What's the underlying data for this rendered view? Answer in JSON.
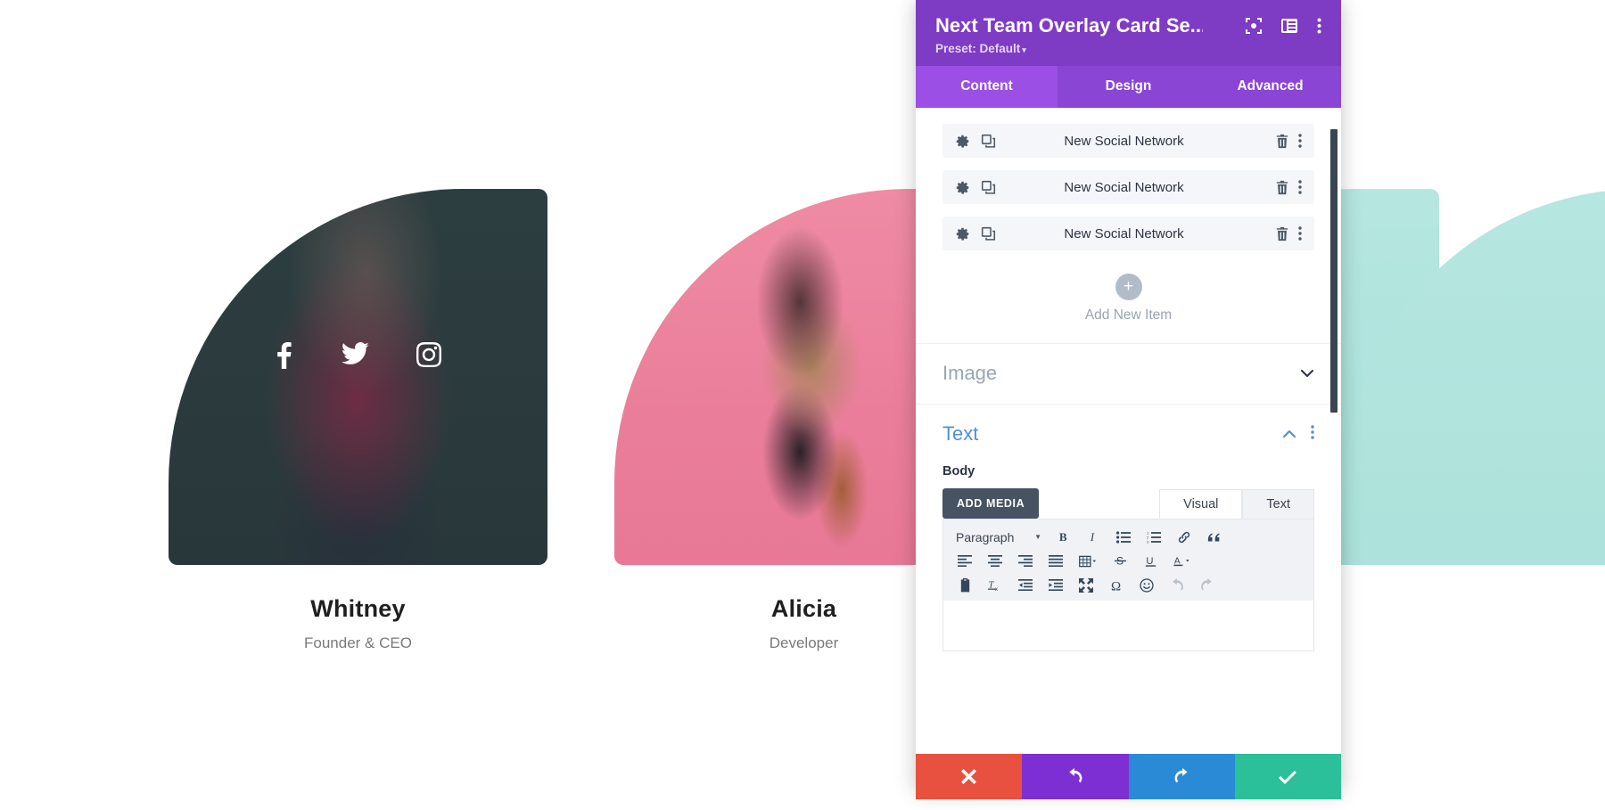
{
  "preview": {
    "team_members": [
      {
        "name": "Whitney",
        "role": "Founder & CEO",
        "overlay_color": "#2d3e40",
        "socials": [
          "facebook-icon",
          "twitter-icon",
          "instagram-icon"
        ]
      },
      {
        "name": "Alicia",
        "role": "Developer",
        "overlay_color": "#ea7e9a",
        "socials": []
      },
      {
        "name": "",
        "role": "",
        "overlay_color": "#aee3dd",
        "socials": []
      },
      {
        "name": "",
        "role": "",
        "overlay_color": "#ace2db",
        "socials": []
      }
    ]
  },
  "panel": {
    "title": "Next Team Overlay Card Se...",
    "preset_label": "Preset: Default",
    "preset_caret": "▾",
    "header_icons": [
      "focus-target-icon",
      "panel-layout-icon",
      "kebab-menu-icon"
    ],
    "tabs": [
      {
        "label": "Content",
        "active": true
      },
      {
        "label": "Design",
        "active": false
      },
      {
        "label": "Advanced",
        "active": false
      }
    ],
    "accent_color": "#7e3bc4",
    "module_items": [
      {
        "label": "New Social Network"
      },
      {
        "label": "New Social Network"
      },
      {
        "label": "New Social Network"
      }
    ],
    "add_new": {
      "plus": "+",
      "label": "Add New Item"
    },
    "sections": [
      {
        "title": "Image",
        "open": false,
        "chevron": "chevron-down-icon"
      },
      {
        "title": "Text",
        "open": true,
        "chevron": "chevron-up-icon"
      }
    ],
    "text_section": {
      "field_label": "Body",
      "add_media_label": "ADD MEDIA",
      "editor_tabs": [
        {
          "label": "Visual",
          "active": true
        },
        {
          "label": "Text",
          "active": false
        }
      ],
      "paragraph_format": "Paragraph",
      "body_value": "",
      "toolbar_rows": [
        [
          "paragraph-format-select",
          "bold-icon",
          "italic-icon",
          "bulleted-list-icon",
          "numbered-list-icon",
          "link-icon",
          "blockquote-icon"
        ],
        [
          "align-left-icon",
          "align-center-icon",
          "align-right-icon",
          "align-justify-icon",
          "table-icon",
          "strikethrough-icon",
          "underline-icon",
          "text-color-icon"
        ],
        [
          "paste-as-text-icon",
          "clear-formatting-icon",
          "outdent-icon",
          "indent-icon",
          "fullscreen-icon",
          "special-character-icon",
          "emoji-icon",
          "undo-icon",
          "redo-icon"
        ]
      ]
    },
    "footer_buttons": [
      {
        "name": "cancel",
        "icon": "close-icon",
        "color": "#e8513f"
      },
      {
        "name": "undo",
        "icon": "undo-icon",
        "color": "#7e2fd4"
      },
      {
        "name": "redo",
        "icon": "redo-icon",
        "color": "#2b8ad6"
      },
      {
        "name": "save",
        "icon": "check-icon",
        "color": "#2bbf9a"
      }
    ]
  }
}
